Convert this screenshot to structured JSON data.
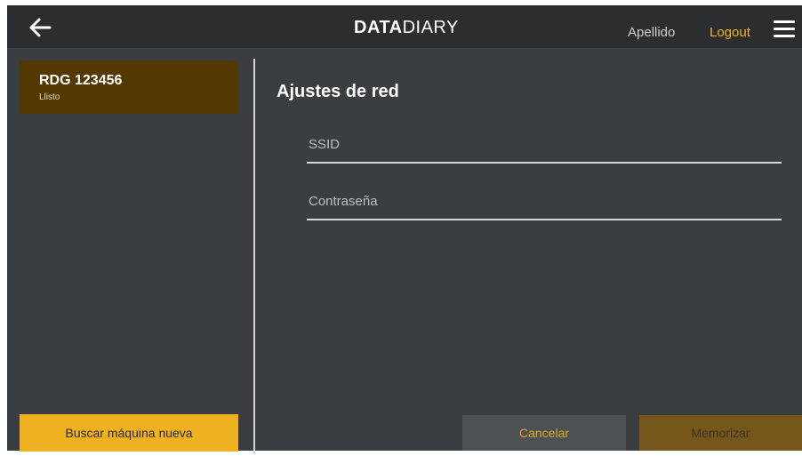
{
  "header": {
    "logo_bold": "DATA",
    "logo_light": "DIARY",
    "user_name": "Apellido",
    "logout_label": "Logout",
    "back_icon": "arrow-left-icon",
    "menu_icon": "hamburger-menu-icon"
  },
  "sidebar": {
    "machines": [
      {
        "id": "RDG 123456",
        "status": "Llisto"
      }
    ],
    "search_button_label": "Buscar máquina nueva"
  },
  "main": {
    "title": "Ajustes de red",
    "fields": {
      "ssid": {
        "placeholder": "SSID",
        "value": ""
      },
      "password": {
        "placeholder": "Contraseña",
        "value": ""
      }
    },
    "cancel_label": "Cancelar",
    "save_label": "Memorizar"
  },
  "colors": {
    "accent": "#efb11f",
    "topbar": "#2b2d2e",
    "background": "#3a3e40",
    "selected_card": "#523801",
    "save_button": "#76561a"
  }
}
